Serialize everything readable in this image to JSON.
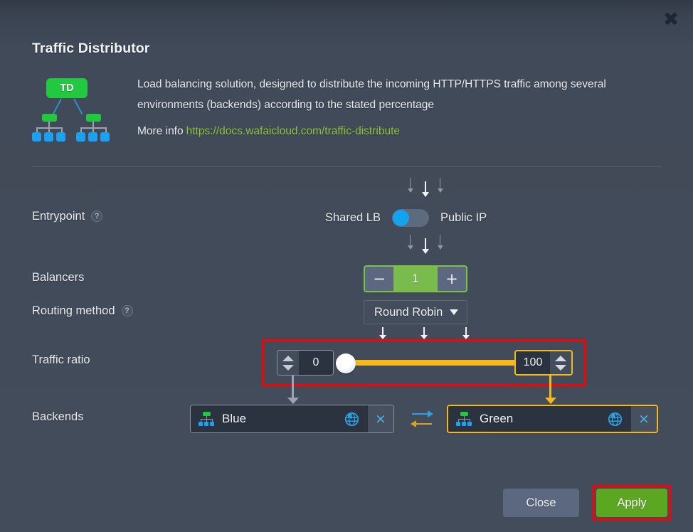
{
  "window": {
    "close_icon": "close-icon",
    "close_glyph": "✖"
  },
  "dialog": {
    "title": "Traffic Distributor",
    "icon_label": "TD",
    "description": "Load balancing solution, designed to distribute the incoming HTTP/HTTPS traffic among several environments (backends) according to the stated percentage",
    "more_info_label": "More info",
    "more_info_url": "https://docs.wafaicloud.com/traffic-distribute"
  },
  "entrypoint": {
    "label": "Entrypoint",
    "help_glyph": "?",
    "left_option": "Shared LB",
    "right_option": "Public IP",
    "selected": "Shared LB"
  },
  "balancers": {
    "label": "Balancers",
    "decrement_glyph": "−",
    "value": "1",
    "increment_glyph": "+"
  },
  "routing_method": {
    "label": "Routing method",
    "help_glyph": "?",
    "selected": "Round Robin"
  },
  "traffic_ratio": {
    "label": "Traffic ratio",
    "left_value": "0",
    "right_value": "100"
  },
  "backends": {
    "label": "Backends",
    "swap_icon": "swap-arrows-icon",
    "items": [
      {
        "name": "Blue",
        "env_icon": "environment-icon",
        "globe_icon": "globe-icon",
        "remove_glyph": "×"
      },
      {
        "name": "Green",
        "env_icon": "environment-icon",
        "globe_icon": "globe-icon",
        "remove_glyph": "×"
      }
    ]
  },
  "footer": {
    "close_label": "Close",
    "apply_label": "Apply"
  },
  "colors": {
    "accent_green": "#22c940",
    "apply_green": "#5ca721",
    "link_green": "#8ec63f",
    "highlight_red": "#ff0000",
    "gold": "#f5b91c",
    "toggle_blue": "#14a3f0",
    "panel_bg": "#434c5a"
  }
}
